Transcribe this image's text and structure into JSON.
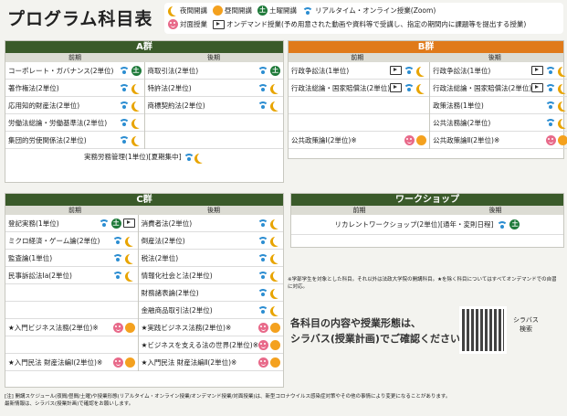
{
  "title": "プログラム科目表",
  "legend": {
    "night": "夜間開講",
    "day": "昼間開講",
    "sat": "土曜開講",
    "realtime": "リアルタイム・オンライン授業(Zoom)",
    "face": "対面授業",
    "ondemand": "オンデマンド授業(予め用意された動画や資料等で受講し、指定の期間内に課題等を提出する授業)"
  },
  "groupA": {
    "title": "A群",
    "sub_early": "前期",
    "sub_late": "後期",
    "early": [
      {
        "name": "コーポレート・ガバナンス(2単位)",
        "icons": [
          "wifi",
          "sat"
        ]
      },
      {
        "name": "著作権法(2単位)",
        "icons": [
          "wifi",
          "moon"
        ]
      },
      {
        "name": "応用知的財産法(2単位)",
        "icons": [
          "wifi",
          "moon"
        ]
      },
      {
        "name": "労働法総論・労働基準法(2単位)",
        "icons": [
          "wifi",
          "moon"
        ]
      },
      {
        "name": "集団的労使関係法(2単位)",
        "icons": [
          "wifi",
          "moon"
        ]
      }
    ],
    "late": [
      {
        "name": "商取引法(2単位)",
        "icons": [
          "wifi",
          "sat"
        ]
      },
      {
        "name": "特許法(2単位)",
        "icons": [
          "wifi",
          "moon"
        ]
      },
      {
        "name": "商標契約法(2単位)",
        "icons": [
          "wifi",
          "moon"
        ]
      },
      {
        "name": "",
        "icons": []
      },
      {
        "name": "",
        "icons": []
      }
    ],
    "foot": "実務労務管理(1単位)[夏期集中]"
  },
  "groupB": {
    "title": "B群",
    "sub_early": "前期",
    "sub_late": "後期",
    "early": [
      {
        "name": "行政争訟法(1単位)",
        "icons": [
          "tv",
          "wifi",
          "moon"
        ]
      },
      {
        "name": "行政法総論・国家賠償法(2単位)",
        "icons": [
          "tv",
          "wifi",
          "moon"
        ]
      },
      {
        "name": "",
        "icons": []
      },
      {
        "name": "",
        "icons": []
      },
      {
        "name": "公共政策論Ⅰ(2単位)※",
        "icons": [
          "face",
          "sun"
        ]
      }
    ],
    "late": [
      {
        "name": "行政争訟法(1単位)",
        "icons": [
          "tv",
          "wifi",
          "moon"
        ]
      },
      {
        "name": "行政法総論・国家賠償法(2単位)",
        "icons": [
          "tv",
          "wifi",
          "moon"
        ]
      },
      {
        "name": "政策法務(1単位)",
        "icons": [
          "wifi",
          "moon"
        ]
      },
      {
        "name": "公共法務論(2単位)",
        "icons": [
          "wifi",
          "moon"
        ]
      },
      {
        "name": "公共政策論Ⅱ(2単位)※",
        "icons": [
          "face",
          "sun"
        ]
      }
    ]
  },
  "groupC": {
    "title": "C群",
    "sub_early": "前期",
    "sub_late": "後期",
    "early": [
      {
        "name": "登記実務(1単位)",
        "icons": [
          "wifi",
          "sat",
          "tv"
        ]
      },
      {
        "name": "ミクロ経済・ゲーム論(2単位)",
        "icons": [
          "wifi",
          "moon"
        ]
      },
      {
        "name": "監査論(1単位)",
        "icons": [
          "wifi",
          "moon"
        ]
      },
      {
        "name": "民事訴訟法Ⅰa(2単位)",
        "icons": [
          "wifi",
          "moon"
        ]
      },
      {
        "name": "",
        "icons": []
      },
      {
        "name": "",
        "icons": []
      },
      {
        "name": "★入門ビジネス法務(2単位)※",
        "icons": [
          "face",
          "sun"
        ]
      },
      {
        "name": "",
        "icons": []
      },
      {
        "name": "★入門民法 財産法編Ⅰ(2単位)※",
        "icons": [
          "face",
          "sun"
        ]
      }
    ],
    "late": [
      {
        "name": "消費者法(2単位)",
        "icons": [
          "wifi",
          "moon"
        ]
      },
      {
        "name": "倒産法(2単位)",
        "icons": [
          "wifi",
          "moon"
        ]
      },
      {
        "name": "税法(2単位)",
        "icons": [
          "wifi",
          "moon"
        ]
      },
      {
        "name": "情報化社会と法(2単位)",
        "icons": [
          "wifi",
          "moon"
        ]
      },
      {
        "name": "財務諸表論(2単位)",
        "icons": [
          "wifi",
          "moon"
        ]
      },
      {
        "name": "金融商品取引法(2単位)",
        "icons": [
          "wifi",
          "moon"
        ]
      },
      {
        "name": "★実践ビジネス法務(2単位)※",
        "icons": [
          "face",
          "sun"
        ]
      },
      {
        "name": "★ビジネスを支える法の世界(2単位)※",
        "icons": [
          "face",
          "sun"
        ]
      },
      {
        "name": "★入門民法 財産法編Ⅱ(2単位)※",
        "icons": [
          "face",
          "sun"
        ]
      }
    ]
  },
  "workshop": {
    "title": "ワークショップ",
    "sub_early": "前期",
    "sub_late": "後期",
    "course": "リカレントワークショップ(2単位)[通年・変則日程]"
  },
  "notes": "※学部学生を対象とした科目。それ以外は法政大学院の開講科目。★を除く科目についてはすべてオンデマンドでの自習に対応。",
  "message": [
    "各科目の内容や授業形態は、",
    "シラバス(授業計画)でご確認ください。"
  ],
  "qr_label": [
    "シラバス",
    "検索"
  ],
  "bottom": [
    "[注] 開講スケジュール(夜間/昼間/土曜)や授業形態(リアルタイム・オンライン授業/オンデマンド授業/対面授業)は、新型コロナウイルス感染症対策やその他の事情により変更になることがあります。",
    "最新情報は、シラバス(授業計画)で確認をお願いします。"
  ]
}
